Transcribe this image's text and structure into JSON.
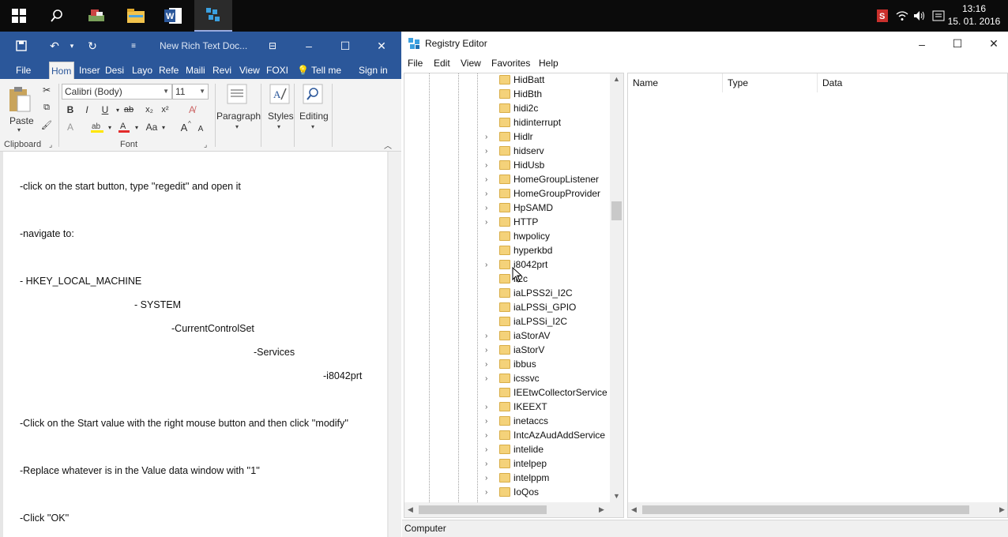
{
  "taskbar": {
    "clock_time": "13:16",
    "clock_date": "15. 01. 2016"
  },
  "word": {
    "doc_title": "New Rich Text Doc...",
    "tabs": [
      {
        "label": "File"
      },
      {
        "label": "Hom"
      },
      {
        "label": "Inser"
      },
      {
        "label": "Desi"
      },
      {
        "label": "Layo"
      },
      {
        "label": "Refe"
      },
      {
        "label": "Maili"
      },
      {
        "label": "Revi"
      },
      {
        "label": "View"
      },
      {
        "label": "FOXI"
      },
      {
        "label": "Tell me"
      },
      {
        "label": "Sign in"
      }
    ],
    "ribbon": {
      "paste_label": "Paste",
      "clipboard_label": "Clipboard",
      "font_name": "Calibri (Body)",
      "font_size": "11",
      "font_label": "Font",
      "paragraph_label": "Paragraph",
      "styles_label": "Styles",
      "editing_label": "Editing",
      "bold": "B",
      "italic": "I",
      "underline": "U",
      "grow": "A",
      "shrink": "A",
      "change_case": "Aa"
    },
    "doc_lines": [
      "-click on the start button, type ''regedit'' and open it",
      "-navigate to:",
      "- HKEY_LOCAL_MACHINE",
      "- SYSTEM",
      "-CurrentControlSet",
      "-Services",
      "-i8042prt",
      "-Click on the Start value with the right mouse button and then click ''modify''",
      "-Replace whatever is in the Value data window with ''1''",
      "-Click ''OK''"
    ]
  },
  "regedit": {
    "title": "Registry Editor",
    "menu": [
      "File",
      "Edit",
      "View",
      "Favorites",
      "Help"
    ],
    "tree_items": [
      {
        "label": "HidBatt",
        "expandable": false
      },
      {
        "label": "HidBth",
        "expandable": false
      },
      {
        "label": "hidi2c",
        "expandable": false
      },
      {
        "label": "hidinterrupt",
        "expandable": false
      },
      {
        "label": "Hidlr",
        "expandable": true
      },
      {
        "label": "hidserv",
        "expandable": true
      },
      {
        "label": "HidUsb",
        "expandable": true
      },
      {
        "label": "HomeGroupListener",
        "expandable": true
      },
      {
        "label": "HomeGroupProvider",
        "expandable": true
      },
      {
        "label": "HpSAMD",
        "expandable": true
      },
      {
        "label": "HTTP",
        "expandable": true
      },
      {
        "label": "hwpolicy",
        "expandable": false
      },
      {
        "label": "hyperkbd",
        "expandable": false
      },
      {
        "label": "i8042prt",
        "expandable": true
      },
      {
        "label": "ii2c",
        "expandable": false
      },
      {
        "label": "iaLPSS2i_I2C",
        "expandable": false
      },
      {
        "label": "iaLPSSi_GPIO",
        "expandable": false
      },
      {
        "label": "iaLPSSi_I2C",
        "expandable": false
      },
      {
        "label": "iaStorAV",
        "expandable": true
      },
      {
        "label": "iaStorV",
        "expandable": true
      },
      {
        "label": "ibbus",
        "expandable": true
      },
      {
        "label": "icssvc",
        "expandable": true
      },
      {
        "label": "IEEtwCollectorService",
        "expandable": false
      },
      {
        "label": "IKEEXT",
        "expandable": true
      },
      {
        "label": "inetaccs",
        "expandable": true
      },
      {
        "label": "IntcAzAudAddService",
        "expandable": true
      },
      {
        "label": "intelide",
        "expandable": true
      },
      {
        "label": "intelpep",
        "expandable": true
      },
      {
        "label": "intelppm",
        "expandable": true
      },
      {
        "label": "IoQos",
        "expandable": true
      }
    ],
    "columns": [
      "Name",
      "Type",
      "Data"
    ],
    "status": "Computer"
  }
}
